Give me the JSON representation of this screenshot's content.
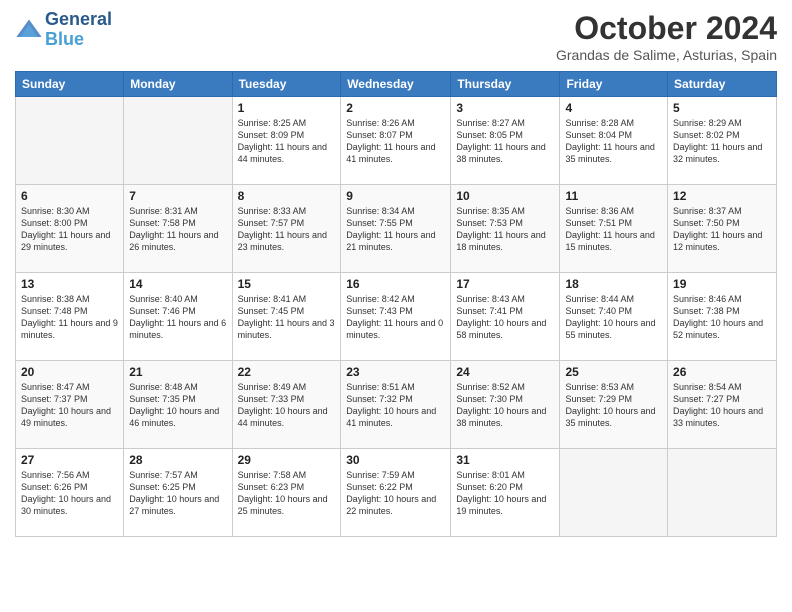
{
  "header": {
    "logo_line1": "General",
    "logo_line2": "Blue",
    "month_title": "October 2024",
    "location": "Grandas de Salime, Asturias, Spain"
  },
  "days_of_week": [
    "Sunday",
    "Monday",
    "Tuesday",
    "Wednesday",
    "Thursday",
    "Friday",
    "Saturday"
  ],
  "weeks": [
    [
      {
        "day": "",
        "empty": true
      },
      {
        "day": "",
        "empty": true
      },
      {
        "day": "1",
        "sunrise": "8:25 AM",
        "sunset": "8:09 PM",
        "daylight": "11 hours and 44 minutes."
      },
      {
        "day": "2",
        "sunrise": "8:26 AM",
        "sunset": "8:07 PM",
        "daylight": "11 hours and 41 minutes."
      },
      {
        "day": "3",
        "sunrise": "8:27 AM",
        "sunset": "8:05 PM",
        "daylight": "11 hours and 38 minutes."
      },
      {
        "day": "4",
        "sunrise": "8:28 AM",
        "sunset": "8:04 PM",
        "daylight": "11 hours and 35 minutes."
      },
      {
        "day": "5",
        "sunrise": "8:29 AM",
        "sunset": "8:02 PM",
        "daylight": "11 hours and 32 minutes."
      }
    ],
    [
      {
        "day": "6",
        "sunrise": "8:30 AM",
        "sunset": "8:00 PM",
        "daylight": "11 hours and 29 minutes."
      },
      {
        "day": "7",
        "sunrise": "8:31 AM",
        "sunset": "7:58 PM",
        "daylight": "11 hours and 26 minutes."
      },
      {
        "day": "8",
        "sunrise": "8:33 AM",
        "sunset": "7:57 PM",
        "daylight": "11 hours and 23 minutes."
      },
      {
        "day": "9",
        "sunrise": "8:34 AM",
        "sunset": "7:55 PM",
        "daylight": "11 hours and 21 minutes."
      },
      {
        "day": "10",
        "sunrise": "8:35 AM",
        "sunset": "7:53 PM",
        "daylight": "11 hours and 18 minutes."
      },
      {
        "day": "11",
        "sunrise": "8:36 AM",
        "sunset": "7:51 PM",
        "daylight": "11 hours and 15 minutes."
      },
      {
        "day": "12",
        "sunrise": "8:37 AM",
        "sunset": "7:50 PM",
        "daylight": "11 hours and 12 minutes."
      }
    ],
    [
      {
        "day": "13",
        "sunrise": "8:38 AM",
        "sunset": "7:48 PM",
        "daylight": "11 hours and 9 minutes."
      },
      {
        "day": "14",
        "sunrise": "8:40 AM",
        "sunset": "7:46 PM",
        "daylight": "11 hours and 6 minutes."
      },
      {
        "day": "15",
        "sunrise": "8:41 AM",
        "sunset": "7:45 PM",
        "daylight": "11 hours and 3 minutes."
      },
      {
        "day": "16",
        "sunrise": "8:42 AM",
        "sunset": "7:43 PM",
        "daylight": "11 hours and 0 minutes."
      },
      {
        "day": "17",
        "sunrise": "8:43 AM",
        "sunset": "7:41 PM",
        "daylight": "10 hours and 58 minutes."
      },
      {
        "day": "18",
        "sunrise": "8:44 AM",
        "sunset": "7:40 PM",
        "daylight": "10 hours and 55 minutes."
      },
      {
        "day": "19",
        "sunrise": "8:46 AM",
        "sunset": "7:38 PM",
        "daylight": "10 hours and 52 minutes."
      }
    ],
    [
      {
        "day": "20",
        "sunrise": "8:47 AM",
        "sunset": "7:37 PM",
        "daylight": "10 hours and 49 minutes."
      },
      {
        "day": "21",
        "sunrise": "8:48 AM",
        "sunset": "7:35 PM",
        "daylight": "10 hours and 46 minutes."
      },
      {
        "day": "22",
        "sunrise": "8:49 AM",
        "sunset": "7:33 PM",
        "daylight": "10 hours and 44 minutes."
      },
      {
        "day": "23",
        "sunrise": "8:51 AM",
        "sunset": "7:32 PM",
        "daylight": "10 hours and 41 minutes."
      },
      {
        "day": "24",
        "sunrise": "8:52 AM",
        "sunset": "7:30 PM",
        "daylight": "10 hours and 38 minutes."
      },
      {
        "day": "25",
        "sunrise": "8:53 AM",
        "sunset": "7:29 PM",
        "daylight": "10 hours and 35 minutes."
      },
      {
        "day": "26",
        "sunrise": "8:54 AM",
        "sunset": "7:27 PM",
        "daylight": "10 hours and 33 minutes."
      }
    ],
    [
      {
        "day": "27",
        "sunrise": "7:56 AM",
        "sunset": "6:26 PM",
        "daylight": "10 hours and 30 minutes."
      },
      {
        "day": "28",
        "sunrise": "7:57 AM",
        "sunset": "6:25 PM",
        "daylight": "10 hours and 27 minutes."
      },
      {
        "day": "29",
        "sunrise": "7:58 AM",
        "sunset": "6:23 PM",
        "daylight": "10 hours and 25 minutes."
      },
      {
        "day": "30",
        "sunrise": "7:59 AM",
        "sunset": "6:22 PM",
        "daylight": "10 hours and 22 minutes."
      },
      {
        "day": "31",
        "sunrise": "8:01 AM",
        "sunset": "6:20 PM",
        "daylight": "10 hours and 19 minutes."
      },
      {
        "day": "",
        "empty": true
      },
      {
        "day": "",
        "empty": true
      }
    ]
  ]
}
